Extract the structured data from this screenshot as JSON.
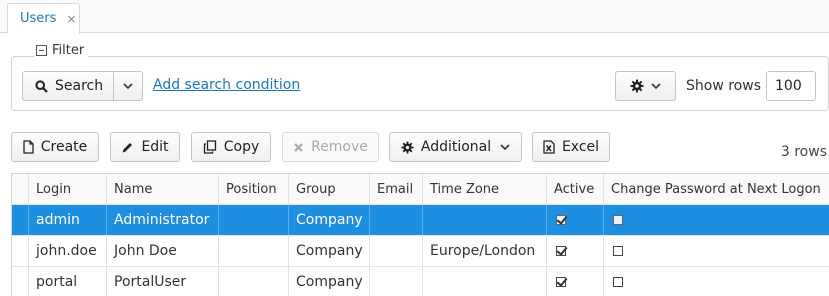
{
  "tab": {
    "label": "Users",
    "close": "×"
  },
  "filter": {
    "legend": "Filter",
    "search_label": "Search",
    "add_condition": "Add search condition",
    "show_rows_label": "Show rows",
    "show_rows_value": "100"
  },
  "toolbar": {
    "create": "Create",
    "edit": "Edit",
    "copy": "Copy",
    "remove": "Remove",
    "additional": "Additional",
    "excel": "Excel",
    "rows_count": "3 rows"
  },
  "table": {
    "columns": [
      "Login",
      "Name",
      "Position",
      "Group",
      "Email",
      "Time Zone",
      "Active",
      "Change Password at Next Logon"
    ],
    "rows": [
      {
        "login": "admin",
        "name": "Administrator",
        "position": "",
        "group": "Company",
        "email": "",
        "timezone": "",
        "active": true,
        "change_password": false,
        "selected": true
      },
      {
        "login": "john.doe",
        "name": "John Doe",
        "position": "",
        "group": "Company",
        "email": "",
        "timezone": "Europe/London",
        "active": true,
        "change_password": false,
        "selected": false
      },
      {
        "login": "portal",
        "name": "PortalUser",
        "position": "",
        "group": "Company",
        "email": "",
        "timezone": "",
        "active": true,
        "change_password": false,
        "selected": false
      }
    ]
  },
  "colors": {
    "accent": "#1a78c2",
    "selection": "#1e8fe0"
  }
}
